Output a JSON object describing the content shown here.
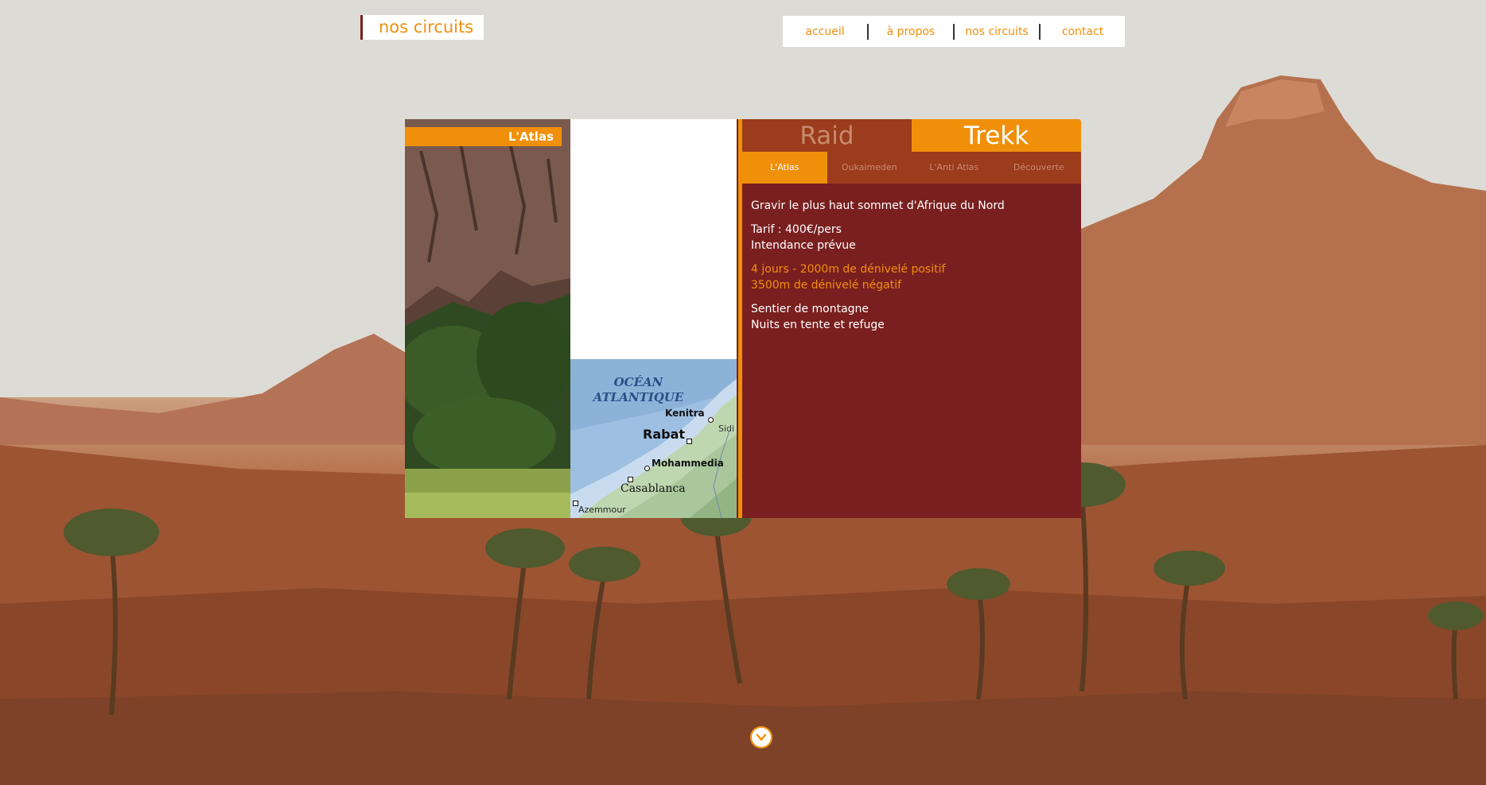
{
  "header": {
    "page_title": "nos circuits"
  },
  "nav": {
    "items": [
      {
        "label": "accueil"
      },
      {
        "label": "à propos"
      },
      {
        "label": "nos circuits"
      },
      {
        "label": "contact"
      }
    ]
  },
  "gallery": {
    "photo_label": "L'Atlas"
  },
  "map": {
    "ocean_line1": "OCÉAN",
    "ocean_line2": "ATLANTIQUE",
    "cities": [
      "Kenitra",
      "Rabat",
      "Sidi",
      "Mohammedia",
      "Casablanca",
      "Azemmour"
    ]
  },
  "tabs": {
    "main": [
      {
        "label": "Raid",
        "active": false
      },
      {
        "label": "Trekk",
        "active": true
      }
    ],
    "sub": [
      {
        "label": "L'Atlas",
        "active": true
      },
      {
        "label": "Oukaimeden",
        "active": false
      },
      {
        "label": "L'Anti Atlas",
        "active": false
      },
      {
        "label": "Découverte",
        "active": false
      }
    ]
  },
  "content": {
    "headline": "Gravir le plus haut sommet d'Afrique du Nord",
    "tarif": "Tarif : 400€/pers",
    "intendance": "Intendance prévue",
    "duration": "4 jours - 2000m de dénivelé positif",
    "descent": "3500m de dénivelé négatif",
    "terrain": "Sentier de montagne",
    "nights": "Nuits en tente et refuge"
  },
  "colors": {
    "accent": "#f0900a",
    "dark_red": "#7a1f1f",
    "tab_inactive": "#9b3c1c"
  },
  "icons": {
    "scroll_down": "chevron-down-icon"
  }
}
